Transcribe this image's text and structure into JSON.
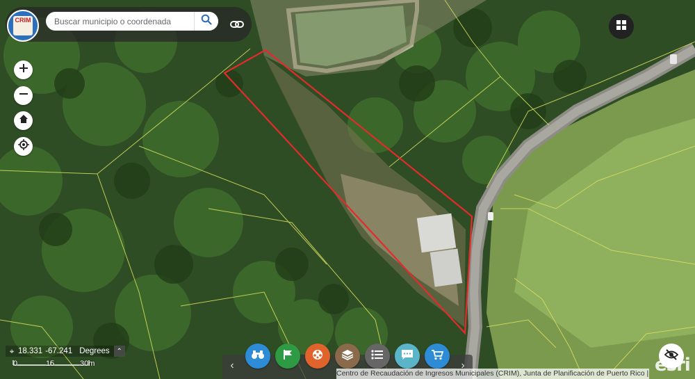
{
  "search": {
    "placeholder": "Buscar municipio o coordenada"
  },
  "logo": {
    "text": "CRIM"
  },
  "coordinates": {
    "lat": "18.331",
    "lon": "-67.241",
    "unit": "Degrees"
  },
  "scale": {
    "labels": [
      "0",
      "15",
      "30m"
    ]
  },
  "attribution": "Centro de Recaudación de Ingresos Municipales (CRIM), Junta de Planificación de Puerto Rico |...",
  "watermark": "esri",
  "toolbar": {
    "tools": [
      {
        "name": "binoculars-icon",
        "color": "#2e8bd6"
      },
      {
        "name": "flag-icon",
        "color": "#2f9a44"
      },
      {
        "name": "film-reel-icon",
        "color": "#e0632b"
      },
      {
        "name": "layers-icon",
        "color": "#8a6a4a"
      },
      {
        "name": "list-icon",
        "color": "#666666"
      },
      {
        "name": "comment-icon",
        "color": "#5bb5c8"
      },
      {
        "name": "cart-icon",
        "color": "#2e8bd6"
      }
    ]
  },
  "colors": {
    "parcel_outline": "#e32b2b",
    "parcel_lines": "#d9e060"
  }
}
